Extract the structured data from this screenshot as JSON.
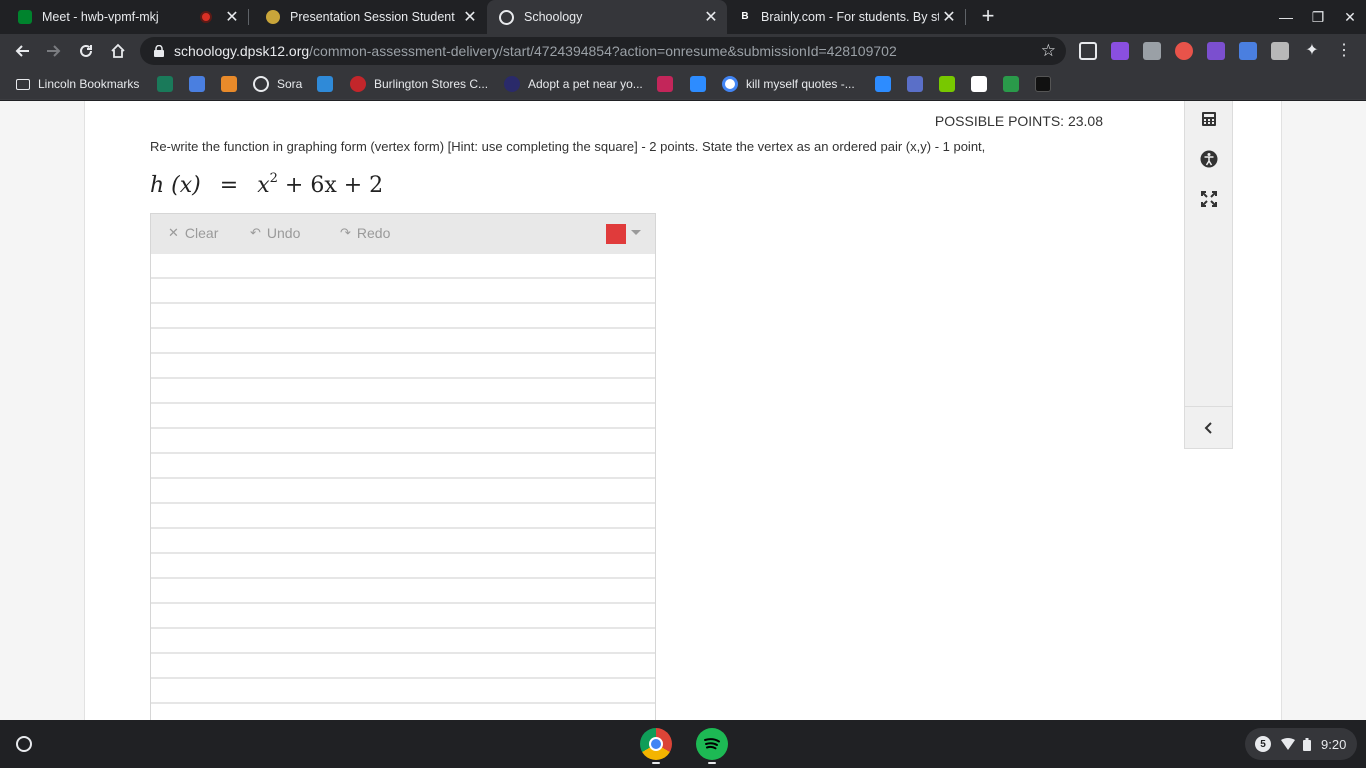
{
  "tabs": [
    {
      "title": "Meet - hwb-vpmf-mkj",
      "favicon": "google-meet-icon",
      "recording": true,
      "active": false
    },
    {
      "title": "Presentation Session Student",
      "favicon": "pear-deck-icon",
      "active": false
    },
    {
      "title": "Schoology",
      "favicon": "schoology-icon",
      "active": true
    },
    {
      "title": "Brainly.com - For students. By st",
      "favicon": "brainly-icon",
      "active": false
    }
  ],
  "address": {
    "host": "schoology.dpsk12.org",
    "path": "/common-assessment-delivery/start/4724394854?action=onresume&submissionId=428109702"
  },
  "bookmarks": [
    {
      "label": "Lincoln Bookmarks",
      "icon": "folder-icon"
    },
    {
      "label": "Sora",
      "icon": "sora-icon"
    },
    {
      "label": "Burlington Stores C...",
      "icon": "burlington-icon"
    },
    {
      "label": "Adopt a pet near yo...",
      "icon": "paw-icon"
    },
    {
      "label": "kill myself quotes -...",
      "icon": "google-icon"
    }
  ],
  "question": {
    "points": "POSSIBLE POINTS: 23.08",
    "prompt": "Re-write the function in graphing form (vertex form) [Hint: use completing the square] - 2 points.  State the vertex as an ordered pair (x,y) - 1 point,",
    "equation": {
      "lhs": "h (x)",
      "equals": "=",
      "base": "x",
      "exponent": "2",
      "rest": "+ 6x + 2"
    }
  },
  "drawing_tools": {
    "clear": "Clear",
    "undo": "Undo",
    "redo": "Redo",
    "pen_color": "#e03b3b"
  },
  "side_tools": [
    "calculator-icon",
    "accessibility-icon",
    "fullscreen-icon",
    "collapse-chevron-icon"
  ],
  "shelf": {
    "apps": [
      "chrome-icon",
      "spotify-icon"
    ],
    "notification_count": "5",
    "time": "9:20"
  },
  "colors": {
    "accent_red": "#e03b3b",
    "chrome_dark": "#202124",
    "toolbar": "#35363a"
  }
}
